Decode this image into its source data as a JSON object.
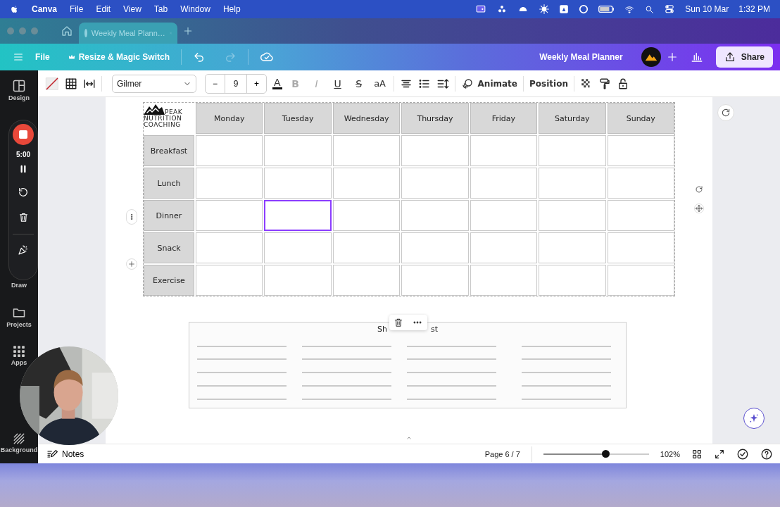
{
  "menubar": {
    "app": "Canva",
    "menus": [
      "File",
      "Edit",
      "View",
      "Tab",
      "Window",
      "Help"
    ],
    "date": "Sun 10 Mar",
    "time": "1:32 PM"
  },
  "browser_tab": {
    "title": "Weekly Meal Plann…"
  },
  "header": {
    "file": "File",
    "resize": "Resize & Magic Switch",
    "undo_disabled": false,
    "redo_disabled": true,
    "design_title": "Weekly Meal Planner",
    "share": "Share"
  },
  "toolbar": {
    "font": "Gilmer",
    "size_minus": "−",
    "font_size": "9",
    "size_plus": "+",
    "text_color": "A",
    "formats": [
      {
        "kind": "bold",
        "label": "B",
        "disabled": true
      },
      {
        "kind": "italic",
        "label": "I",
        "disabled": true
      },
      {
        "kind": "underline",
        "label": "U",
        "disabled": false
      },
      {
        "kind": "strike",
        "label": "S",
        "disabled": false
      },
      {
        "kind": "case",
        "label": "aA",
        "disabled": false
      }
    ],
    "animate": "Animate",
    "position": "Position"
  },
  "sidebar": [
    {
      "kind": "design",
      "label": "Design"
    },
    {
      "kind": "draw",
      "label": "Draw"
    },
    {
      "kind": "projects",
      "label": "Projects"
    },
    {
      "kind": "apps",
      "label": "Apps"
    },
    {
      "kind": "background",
      "label": "Background"
    }
  ],
  "recorder": {
    "time": "5:00"
  },
  "planner": {
    "logo": [
      "PEAK",
      "NUTRITION",
      "COACHING"
    ],
    "days": [
      "Monday",
      "Tuesday",
      "Wednesday",
      "Thursday",
      "Friday",
      "Saturday",
      "Sunday"
    ],
    "rows": [
      {
        "label": "Breakfast",
        "cells": [
          {
            "selected": false
          },
          {
            "selected": false
          },
          {
            "selected": false
          },
          {
            "selected": false
          },
          {
            "selected": false
          },
          {
            "selected": false
          },
          {
            "selected": false
          }
        ]
      },
      {
        "label": "Lunch",
        "cells": [
          {
            "selected": false
          },
          {
            "selected": false
          },
          {
            "selected": false
          },
          {
            "selected": false
          },
          {
            "selected": false
          },
          {
            "selected": false
          },
          {
            "selected": false
          }
        ]
      },
      {
        "label": "Dinner",
        "cells": [
          {
            "selected": false
          },
          {
            "selected": true
          },
          {
            "selected": false
          },
          {
            "selected": false
          },
          {
            "selected": false
          },
          {
            "selected": false
          },
          {
            "selected": false
          }
        ]
      },
      {
        "label": "Snack",
        "cells": [
          {
            "selected": false
          },
          {
            "selected": false
          },
          {
            "selected": false
          },
          {
            "selected": false
          },
          {
            "selected": false
          },
          {
            "selected": false
          },
          {
            "selected": false
          }
        ]
      },
      {
        "label": "Exercise",
        "cells": [
          {
            "selected": false
          },
          {
            "selected": false
          },
          {
            "selected": false
          },
          {
            "selected": false
          },
          {
            "selected": false
          },
          {
            "selected": false
          },
          {
            "selected": false
          }
        ]
      }
    ]
  },
  "shopping_list": {
    "title_parts": [
      "Sh",
      "st"
    ]
  },
  "footer": {
    "notes": "Notes",
    "page": "Page 6 / 7",
    "zoom": {
      "level": 0.59
    },
    "zoom_label": "102%"
  }
}
